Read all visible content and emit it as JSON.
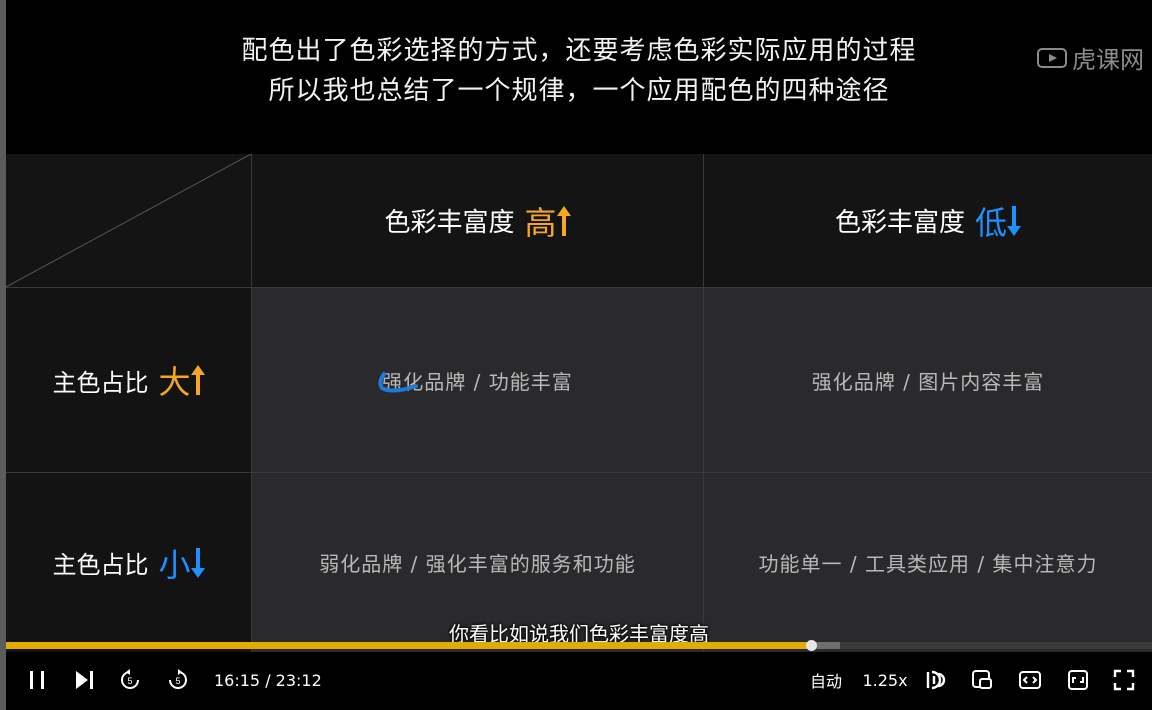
{
  "video": {
    "caption_line1": "配色出了色彩选择的方式，还要考虑色彩实际应用的过程",
    "caption_line2": "所以我也总结了一个规律，一个应用配色的四种途径",
    "watermark": "虎课网",
    "subtitle": "你看比如说我们色彩丰富度高"
  },
  "slide": {
    "col_headers": [
      {
        "label": "色彩丰富度",
        "level": "高",
        "arrow": "up",
        "color": "#f5a623"
      },
      {
        "label": "色彩丰富度",
        "level": "低",
        "arrow": "down",
        "color": "#1e90ff"
      }
    ],
    "row_headers": [
      {
        "label": "主色占比",
        "level": "大",
        "arrow": "up",
        "color": "#f5a623"
      },
      {
        "label": "主色占比",
        "level": "小",
        "arrow": "down",
        "color": "#1e90ff"
      }
    ],
    "cells": [
      [
        "强化品牌 / 功能丰富",
        "强化品牌 / 图片内容丰富"
      ],
      [
        "弱化品牌 / 强化丰富的服务和功能",
        "功能单一 / 工具类应用 / 集中注意力"
      ]
    ]
  },
  "player": {
    "progress_fraction": 0.7028,
    "buffer_fraction": 0.728,
    "current_time": "16:15",
    "separator": "/",
    "duration": "23:12",
    "time_display": "16:15 / 23:12",
    "quality": "自动",
    "speed": "1.25x",
    "icons": [
      "pause-icon",
      "next-icon",
      "rewind-5-icon",
      "forward-5-icon",
      "danmaku-icon",
      "pip-icon",
      "web-fullscreen-icon",
      "wide-mode-icon",
      "fullscreen-icon"
    ],
    "accent_color": "#e0ac00"
  }
}
